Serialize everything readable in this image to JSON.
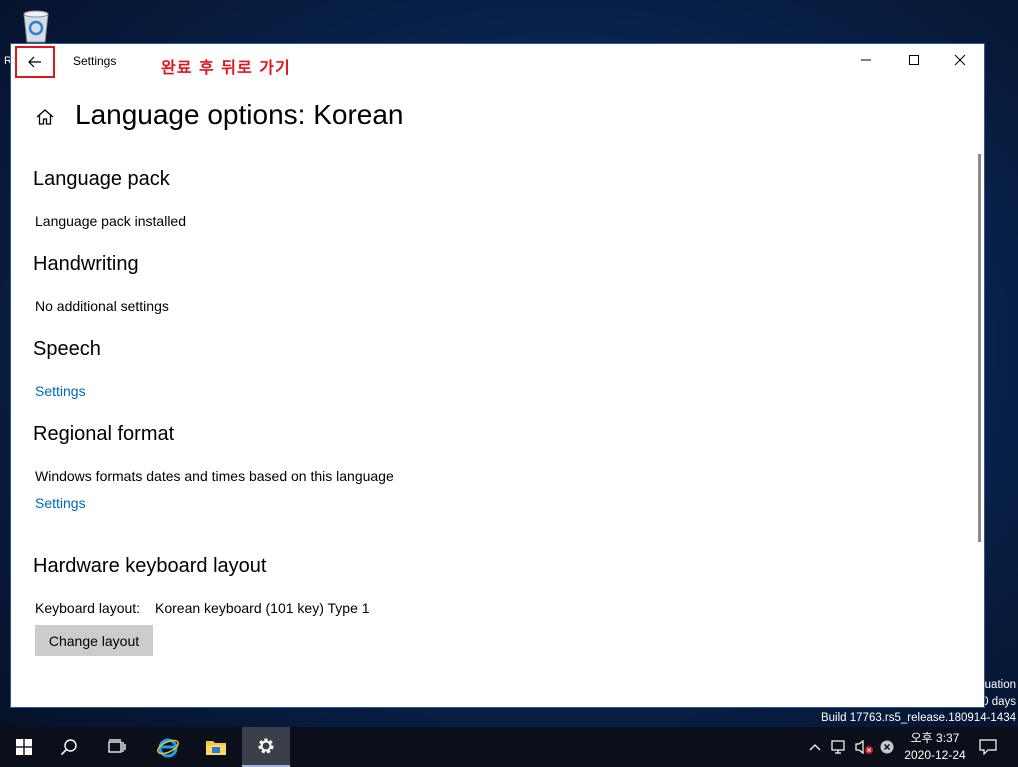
{
  "desktop": {
    "recycle_bin_label": "R",
    "watermark": [
      "uation",
      "0 days",
      "Build 17763.rs5_release.180914-1434"
    ]
  },
  "window": {
    "title": "Settings",
    "annotation": "완료 후 뒤로 가기",
    "page_title": "Language options: Korean"
  },
  "sections": {
    "language_pack": {
      "heading": "Language pack",
      "status": "Language pack installed"
    },
    "handwriting": {
      "heading": "Handwriting",
      "status": "No additional settings"
    },
    "speech": {
      "heading": "Speech",
      "link": "Settings"
    },
    "regional_format": {
      "heading": "Regional format",
      "description": "Windows formats dates and times based on this language",
      "link": "Settings"
    },
    "keyboard": {
      "heading": "Hardware keyboard layout",
      "label": "Keyboard layout:",
      "value": "Korean keyboard (101 key) Type 1",
      "button": "Change layout"
    }
  },
  "taskbar": {
    "time": "오후 3:37",
    "date": "2020-12-24",
    "icons": [
      "start-icon",
      "search-icon",
      "task-view-icon",
      "internet-explorer-icon",
      "file-explorer-icon",
      "settings-icon"
    ]
  },
  "colors": {
    "accent_link": "#0067c0",
    "annotation_red": "#e0141c",
    "button_gray": "#cccccc"
  }
}
